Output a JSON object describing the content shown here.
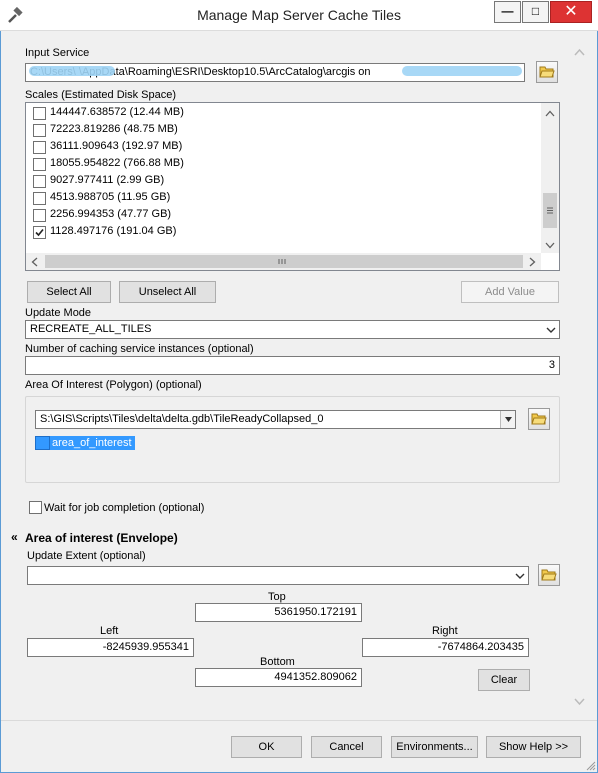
{
  "window": {
    "title": "Manage Map Server Cache Tiles",
    "minimize": "—",
    "maximize": "□",
    "close": "✕"
  },
  "input_service": {
    "label": "Input Service",
    "value": "C:\\Users\\          \\AppData\\Roaming\\ESRI\\Desktop10.5\\ArcCatalog\\arcgis on"
  },
  "scales": {
    "label": "Scales (Estimated Disk Space)",
    "items": [
      {
        "label": "144447.638572 (12.44 MB)",
        "checked": false
      },
      {
        "label": "72223.819286 (48.75 MB)",
        "checked": false
      },
      {
        "label": "36111.909643 (192.97 MB)",
        "checked": false
      },
      {
        "label": "18055.954822 (766.88 MB)",
        "checked": false
      },
      {
        "label": "9027.977411 (2.99 GB)",
        "checked": false
      },
      {
        "label": "4513.988705 (11.95 GB)",
        "checked": false
      },
      {
        "label": "2256.994353 (47.77 GB)",
        "checked": false
      },
      {
        "label": "1128.497176 (191.04 GB)",
        "checked": true
      }
    ]
  },
  "buttons": {
    "select_all": "Select All",
    "unselect_all": "Unselect All",
    "add_value": "Add Value",
    "clear": "Clear",
    "ok": "OK",
    "cancel": "Cancel",
    "environments": "Environments...",
    "show_help": "Show Help >>"
  },
  "update_mode": {
    "label": "Update Mode",
    "value": "RECREATE_ALL_TILES"
  },
  "instances": {
    "label": "Number of caching service instances (optional)",
    "value": "3"
  },
  "aoi_polygon": {
    "label": "Area Of Interest (Polygon) (optional)",
    "value": "S:\\GIS\\Scripts\\Tiles\\delta\\delta.gdb\\TileReadyCollapsed_0",
    "layer": "area_of_interest"
  },
  "wait": {
    "label": "Wait for job completion (optional)",
    "checked": false
  },
  "envelope": {
    "section_title": "Area of interest (Envelope)",
    "collapse_glyph": "«",
    "update_extent_label": "Update Extent (optional)",
    "update_extent_value": "",
    "top_label": "Top",
    "top": "5361950.172191",
    "left_label": "Left",
    "left": "-8245939.955341",
    "right_label": "Right",
    "right": "-7674864.203435",
    "bottom_label": "Bottom",
    "bottom": "4941352.809062"
  },
  "colors": {
    "accent": "#3399ff",
    "window_border": "#5b9bd5",
    "close_button": "#d33333"
  }
}
